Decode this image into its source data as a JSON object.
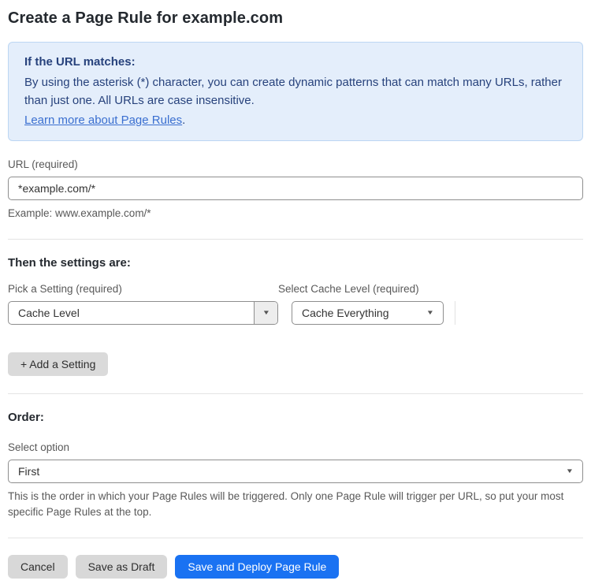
{
  "page": {
    "title": "Create a Page Rule for example.com"
  },
  "info_box": {
    "heading": "If the URL matches:",
    "body": "By using the asterisk (*) character, you can create dynamic patterns that can match many URLs, rather than just one. All URLs are case insensitive.",
    "link_label": "Learn more about Page Rules",
    "link_suffix": "."
  },
  "url_field": {
    "label": "URL (required)",
    "value": "*example.com/*",
    "helper": "Example: www.example.com/*"
  },
  "settings_section": {
    "heading": "Then the settings are:",
    "setting_picker": {
      "label": "Pick a Setting (required)",
      "selected_value": "Cache Level"
    },
    "cache_level_picker": {
      "label": "Select Cache Level (required)",
      "selected_value": "Cache Everything"
    },
    "add_setting_label": "+ Add a Setting"
  },
  "order_section": {
    "heading": "Order:",
    "label": "Select option",
    "selected_value": "First",
    "helper": "This is the order in which your Page Rules will be triggered. Only one Page Rule will trigger per URL, so put your most specific Page Rules at the top."
  },
  "actions": {
    "cancel_label": "Cancel",
    "save_draft_label": "Save as Draft",
    "save_deploy_label": "Save and Deploy Page Rule"
  },
  "icons": {
    "caret_down": "▼"
  },
  "colors": {
    "accent_blue": "#1a72f2",
    "info_bg": "#e4eefb",
    "info_text": "#27427c",
    "link_blue": "#3a6fd0"
  }
}
